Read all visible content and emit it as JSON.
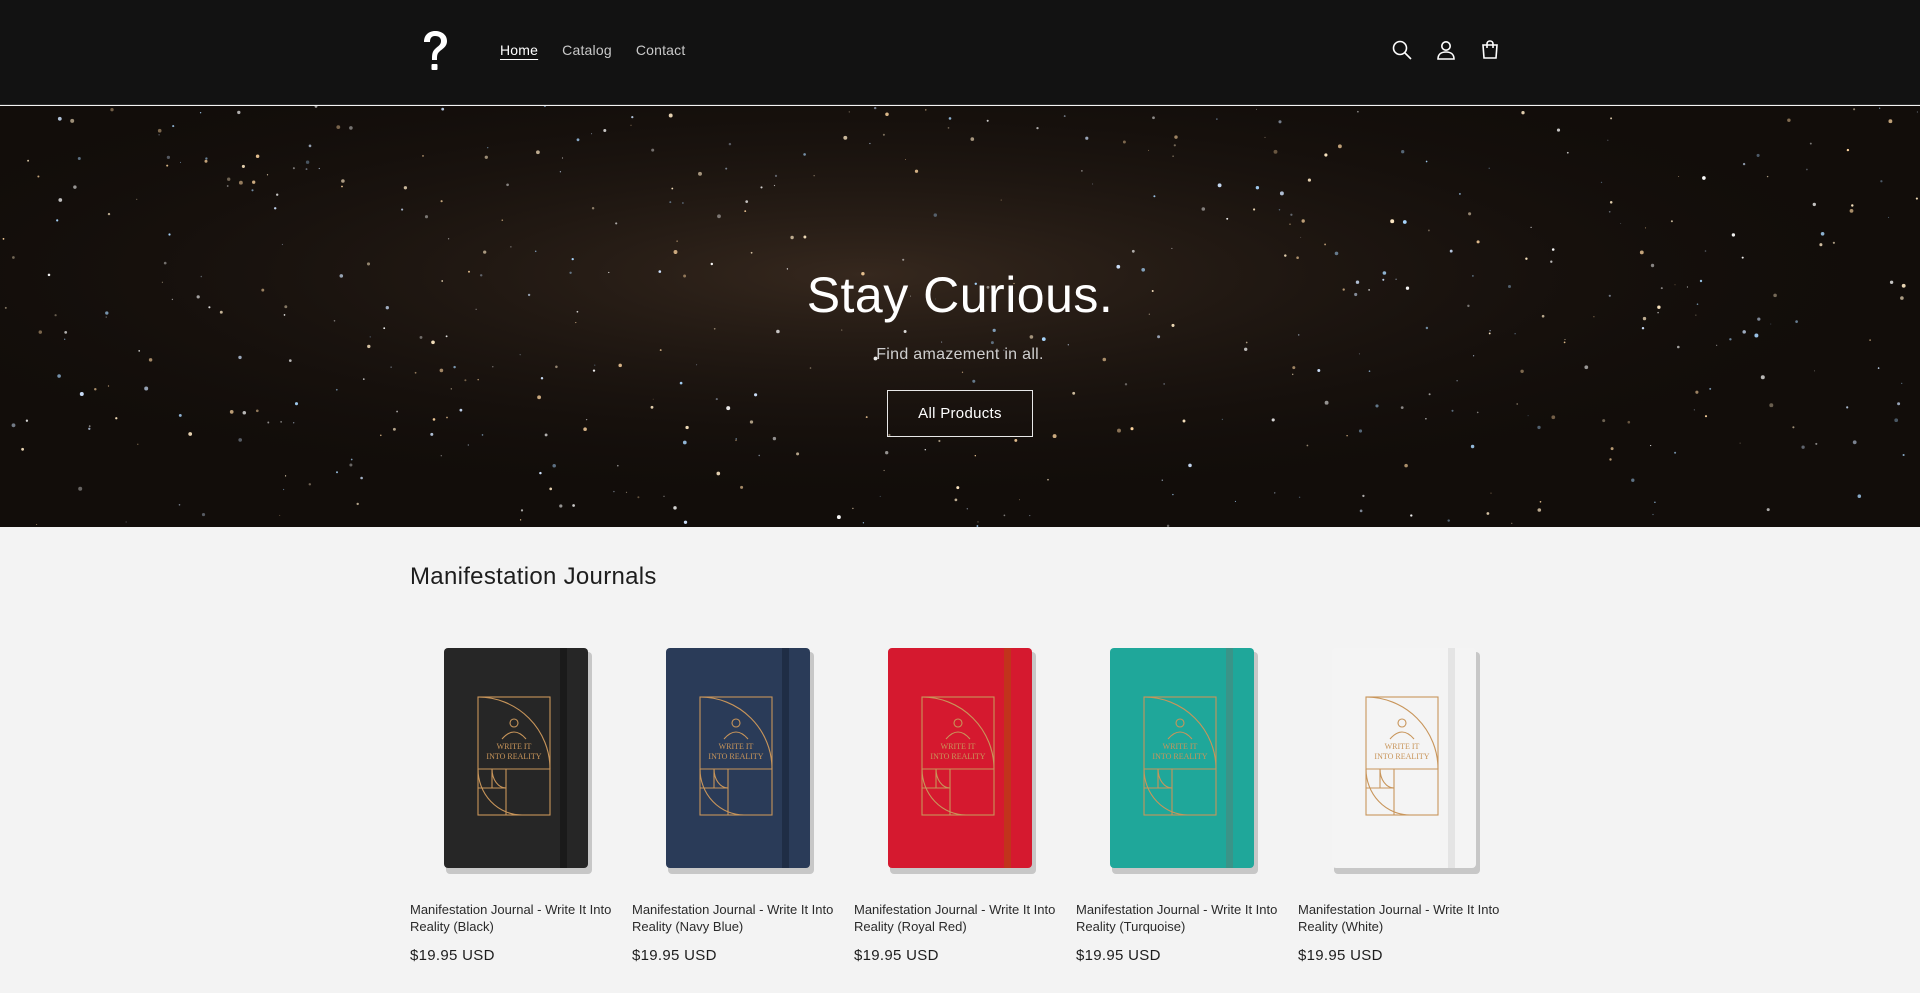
{
  "header": {
    "logo_icon": "question-mark-logo",
    "nav": [
      {
        "label": "Home",
        "active": true
      },
      {
        "label": "Catalog",
        "active": false
      },
      {
        "label": "Contact",
        "active": false
      }
    ],
    "icons": [
      "search-icon",
      "account-icon",
      "cart-icon"
    ]
  },
  "hero": {
    "title": "Stay Curious.",
    "subtitle": "Find amazement in all.",
    "button_label": "All Products"
  },
  "collection": {
    "title": "Manifestation Journals",
    "products": [
      {
        "name": "Manifestation Journal - Write It Into Reality (Black)",
        "price": "$19.95 USD",
        "cover": "#262626",
        "band": "#1a1a1a",
        "emblem_text": "WRITE IT INTO REALITY"
      },
      {
        "name": "Manifestation Journal - Write It Into Reality (Navy Blue)",
        "price": "$19.95 USD",
        "cover": "#2a3b58",
        "band": "#1f2d45",
        "emblem_text": "WRITE IT INTO REALITY"
      },
      {
        "name": "Manifestation Journal - Write It Into Reality (Royal Red)",
        "price": "$19.95 USD",
        "cover": "#d5192f",
        "band": "#c1331c",
        "emblem_text": "WRITE IT INTO REALITY"
      },
      {
        "name": "Manifestation Journal - Write It Into Reality (Turquoise)",
        "price": "$19.95 USD",
        "cover": "#1fa79a",
        "band": "#3a9488",
        "emblem_text": "WRITE IT INTO REALITY"
      },
      {
        "name": "Manifestation Journal - Write It Into Reality (White)",
        "price": "$19.95 USD",
        "cover": "#f4f4f4",
        "band": "#e4e4e4",
        "emblem_text": "WRITE IT INTO REALITY"
      }
    ]
  },
  "colors": {
    "header_bg": "#121212",
    "hero_bg": "#120d0a",
    "page_bg": "#f3f3f3",
    "emblem_gold": "#c8955a"
  }
}
